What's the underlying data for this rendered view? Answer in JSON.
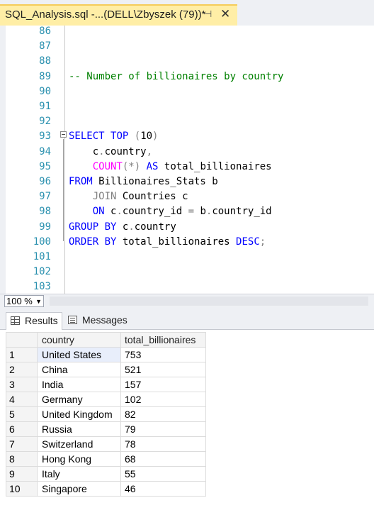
{
  "tab": {
    "title": "SQL_Analysis.sql -...(DELL\\Zbyszek (79))*",
    "pin_glyph": "⊣",
    "close_glyph": "✕"
  },
  "editor": {
    "lines": [
      {
        "no": "86",
        "segments": []
      },
      {
        "no": "87",
        "segments": []
      },
      {
        "no": "88",
        "segments": []
      },
      {
        "no": "89",
        "segments": [
          {
            "t": "-- Number of billionaires by country",
            "c": "cm"
          }
        ]
      },
      {
        "no": "90",
        "segments": []
      },
      {
        "no": "91",
        "segments": []
      },
      {
        "no": "92",
        "segments": []
      },
      {
        "no": "93",
        "segments": [
          {
            "t": "SELECT",
            "c": "kw"
          },
          {
            "t": " "
          },
          {
            "t": "TOP",
            "c": "kw"
          },
          {
            "t": " "
          },
          {
            "t": "(",
            "c": "op"
          },
          {
            "t": "10"
          },
          {
            "t": ")",
            "c": "op"
          }
        ]
      },
      {
        "no": "94",
        "segments": [
          {
            "t": "    c"
          },
          {
            "t": ".",
            "c": "op"
          },
          {
            "t": "country"
          },
          {
            "t": ",",
            "c": "op"
          }
        ]
      },
      {
        "no": "95",
        "segments": [
          {
            "t": "    "
          },
          {
            "t": "COUNT",
            "c": "fn"
          },
          {
            "t": "(*)",
            "c": "op"
          },
          {
            "t": " "
          },
          {
            "t": "AS",
            "c": "kw"
          },
          {
            "t": " total_billionaires"
          }
        ]
      },
      {
        "no": "96",
        "segments": [
          {
            "t": "FROM",
            "c": "kw"
          },
          {
            "t": " Billionaires_Stats b"
          }
        ]
      },
      {
        "no": "97",
        "segments": [
          {
            "t": "    "
          },
          {
            "t": "JOIN",
            "c": "op"
          },
          {
            "t": " Countries c"
          }
        ]
      },
      {
        "no": "98",
        "segments": [
          {
            "t": "    "
          },
          {
            "t": "ON",
            "c": "kw"
          },
          {
            "t": " c"
          },
          {
            "t": ".",
            "c": "op"
          },
          {
            "t": "country_id "
          },
          {
            "t": "=",
            "c": "op"
          },
          {
            "t": " b"
          },
          {
            "t": ".",
            "c": "op"
          },
          {
            "t": "country_id"
          }
        ]
      },
      {
        "no": "99",
        "segments": [
          {
            "t": "GROUP",
            "c": "kw"
          },
          {
            "t": " "
          },
          {
            "t": "BY",
            "c": "kw"
          },
          {
            "t": " c"
          },
          {
            "t": ".",
            "c": "op"
          },
          {
            "t": "country"
          }
        ]
      },
      {
        "no": "100",
        "segments": [
          {
            "t": "ORDER",
            "c": "kw"
          },
          {
            "t": " "
          },
          {
            "t": "BY",
            "c": "kw"
          },
          {
            "t": " total_billionaires "
          },
          {
            "t": "DESC",
            "c": "kw"
          },
          {
            "t": ";",
            "c": "op"
          }
        ]
      },
      {
        "no": "101",
        "segments": []
      },
      {
        "no": "102",
        "segments": []
      },
      {
        "no": "103",
        "segments": []
      }
    ]
  },
  "zoom": {
    "value": "100 %",
    "dropdown_glyph": "▼"
  },
  "result_tabs": {
    "results_label": "Results",
    "messages_label": "Messages"
  },
  "results": {
    "columns": [
      "country",
      "total_billionaires"
    ],
    "rows": [
      [
        "1",
        "United States",
        "753"
      ],
      [
        "2",
        "China",
        "521"
      ],
      [
        "3",
        "India",
        "157"
      ],
      [
        "4",
        "Germany",
        "102"
      ],
      [
        "5",
        "United Kingdom",
        "82"
      ],
      [
        "6",
        "Russia",
        "79"
      ],
      [
        "7",
        "Switzerland",
        "78"
      ],
      [
        "8",
        "Hong Kong",
        "68"
      ],
      [
        "9",
        "Italy",
        "55"
      ],
      [
        "10",
        "Singapore",
        "46"
      ]
    ]
  }
}
